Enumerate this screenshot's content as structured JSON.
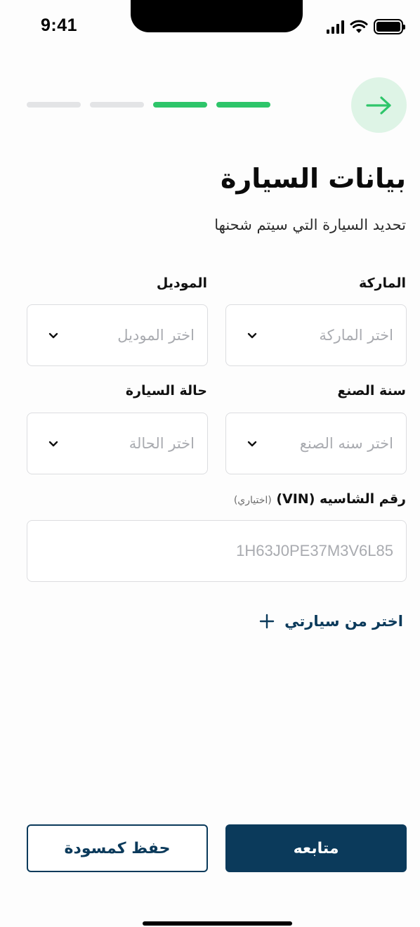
{
  "status_bar": {
    "time": "9:41"
  },
  "header": {
    "progress": {
      "total_steps": 4,
      "completed_steps": 2
    },
    "back_icon": "arrow-right-icon",
    "accent_color": "#2ec56a"
  },
  "page": {
    "title": "بيانات السيارة",
    "subtitle": "تحديد السيارة التي سيتم شحنها"
  },
  "form": {
    "brand": {
      "label": "الماركة",
      "placeholder": "اختر الماركة"
    },
    "model": {
      "label": "الموديل",
      "placeholder": "اختر الموديل"
    },
    "year": {
      "label": "سنة الصنع",
      "placeholder": "اختر سنه الصنع"
    },
    "condition": {
      "label": "حالة السيارة",
      "placeholder": "اختر الحالة"
    },
    "vin": {
      "label": "رقم الشاسيه (VIN)",
      "optional": "(اختياري)",
      "placeholder": "1H63J0PE37M3V6L85"
    },
    "pick_mine": {
      "label": "اختر من سيارتي",
      "icon": "plus-icon"
    }
  },
  "actions": {
    "continue_label": "متابعه",
    "save_draft_label": "حفظ كمسودة",
    "primary_color": "#0b3a5b"
  }
}
